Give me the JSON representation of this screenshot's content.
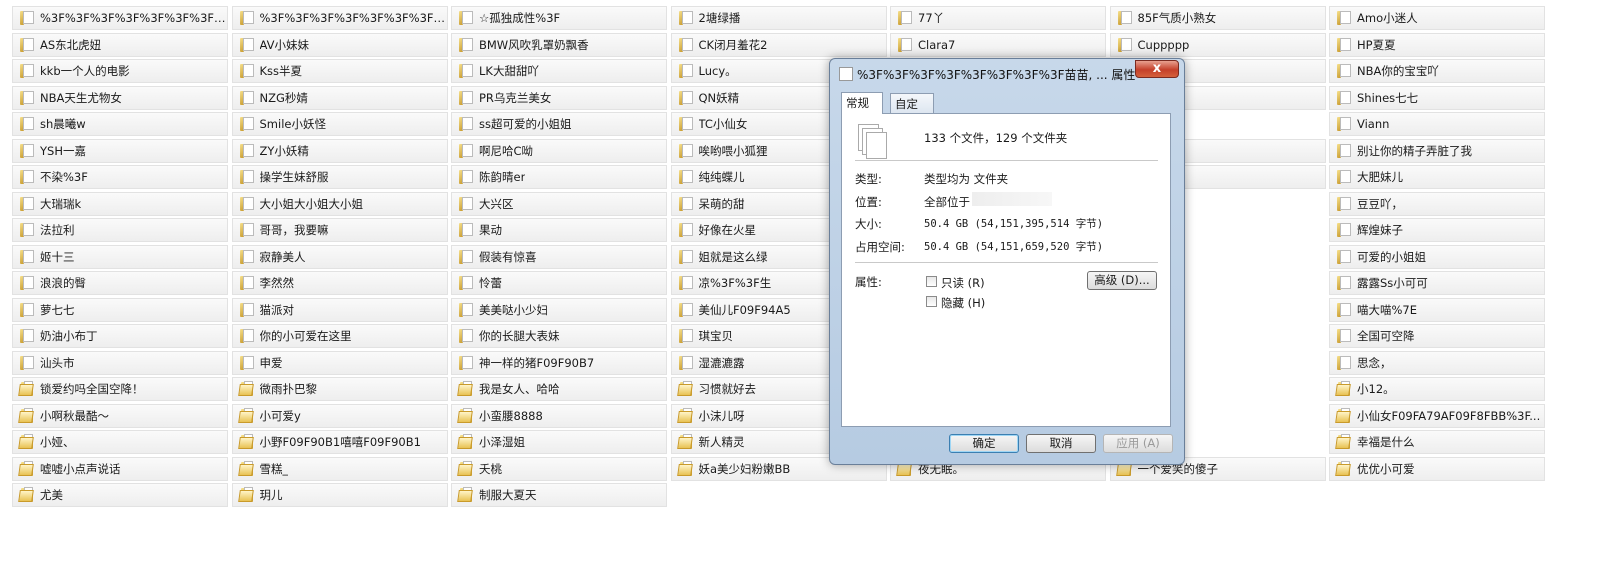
{
  "folders": [
    [
      "%3F%3F%3F%3F%3F%3F%3F%3...",
      "%3F%3F%3F%3F%3F%3F%3F迪...",
      "☆孤独成性%3F",
      "2塘绿播",
      "77丫",
      "85F气质小熟女",
      "Amo小迷人"
    ],
    [
      "AS东北虎妞",
      "AV小妹妹",
      "BMW风吹乳罩奶飘香",
      "CK闭月羞花2",
      "Clara7",
      "Cuppppp",
      "HP夏夏"
    ],
    [
      "kkb一个人的电影",
      "Kss半夏",
      "LK大甜甜吖",
      "Lucy。",
      "",
      "队长",
      "NBA你的宝宝吖"
    ],
    [
      "NBA天生尤物女",
      "NZG秒婧",
      "PR乌克兰美女",
      "QN妖精",
      "",
      "girl～",
      "Shines七七"
    ],
    [
      "sh晨曦w",
      "Smile小妖怪",
      "ss超可爱的小姐姐",
      "TC小仙女",
      "",
      "",
      "Viann"
    ],
    [
      "YSH一嘉",
      "ZY小妖精",
      "啊尼哈C呦",
      "唉哟喂小狐狸",
      "",
      "我",
      "别让你的精子弄脏了我"
    ],
    [
      "不染%3F",
      "操学生妹舒服",
      "陈韵晴er",
      "纯纯蝶儿",
      "",
      "3",
      "大肥妹儿"
    ],
    [
      "大瑞瑞k",
      "大小姐大小姐大小姐",
      "大兴区",
      "呆萌的甜",
      "",
      "",
      "豆豆吖，"
    ],
    [
      "法拉利",
      "哥哥，我要嘛",
      "果动",
      "好像在火星",
      "",
      "",
      "辉煌妹子"
    ],
    [
      "姬十三",
      "寂静美人",
      "假装有惊喜",
      "姐就是这么绿",
      "",
      "",
      "可爱的小姐姐"
    ],
    [
      "浪浪的臀",
      "李然然",
      "怜蕾",
      "凉%3F%3F生",
      "",
      "",
      "露露Ss小可可"
    ],
    [
      "萝七七",
      "猫派对",
      "美美哒小少妇",
      "美仙儿F09F94A5",
      "",
      "",
      "喵大喵%7E"
    ],
    [
      "奶油小布丁",
      "你的小可爱在这里",
      "你的长腿大表妹",
      "琪宝贝",
      "",
      "",
      "全国可空降"
    ],
    [
      "汕头市",
      "申爱",
      "神一样的猪F09F90B7",
      "湿漉漉露",
      "",
      "",
      "思念，"
    ],
    [
      "锁爱约吗全国空降！",
      "微雨扑巴黎",
      "我是女人、哈哈",
      "习惯就好去",
      "",
      "",
      "小12。"
    ],
    [
      "小啊秋最酷～",
      "小可爱y",
      "小蛮腰8888",
      "小沫儿呀",
      "",
      "",
      "小仙女F09FA79AF09F8FBB%3F..."
    ],
    [
      "小娅、",
      "小野F09F90B1嘻嘻F09F90B1",
      "小泽湿姐",
      "新人精灵",
      "",
      "",
      "幸福是什么"
    ],
    [
      "嘘嘘小点声说话",
      "雪糕_",
      "夭桃",
      "妖a美少妇粉嫩BB",
      "夜无眠。",
      "一个爱笑的傻子",
      "优优小可爱"
    ],
    [
      "尤美",
      "玥儿",
      "制服大夏天",
      "",
      "",
      "",
      ""
    ]
  ],
  "dialog": {
    "title": "%3F%3F%3F%3F%3F%3F%3F%3F苗苗, ... 属性",
    "close": "x",
    "tabs": [
      "常规",
      "自定义"
    ],
    "summary": "133 个文件，129 个文件夹",
    "type_label": "类型:",
    "type_value": "类型均为 文件夹",
    "location_label": "位置:",
    "location_value": "全部位于",
    "size_label": "大小:",
    "size_value": "50.4 GB (54,151,395,514 字节)",
    "disk_label": "占用空间:",
    "disk_value": "50.4 GB (54,151,659,520 字节)",
    "attr_label": "属性:",
    "readonly": "只读 (R)",
    "hidden": "隐藏 (H)",
    "advanced": "高级 (D)...",
    "ok": "确定",
    "cancel": "取消",
    "apply": "应用 (A)"
  }
}
